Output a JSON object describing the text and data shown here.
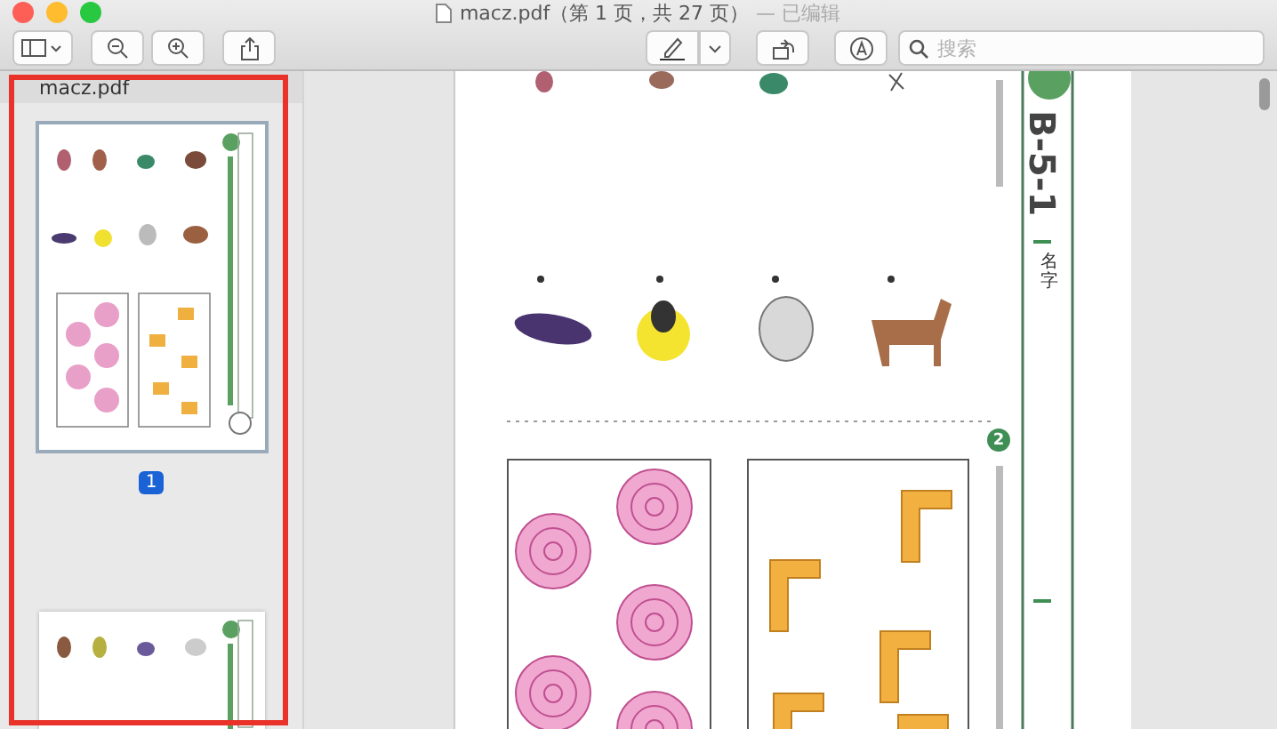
{
  "window": {
    "title": "macz.pdf（第 1 页，共 27 页）",
    "status": "— 已编辑"
  },
  "toolbar": {
    "search": {
      "placeholder": "搜索"
    }
  },
  "sidebar": {
    "title": "macz.pdf",
    "pages": [
      {
        "label": "1",
        "selected": true
      },
      {
        "selected": false
      }
    ]
  },
  "document": {
    "exercise_code": "B-5-1",
    "name_label": "名字",
    "question_number": "2"
  }
}
